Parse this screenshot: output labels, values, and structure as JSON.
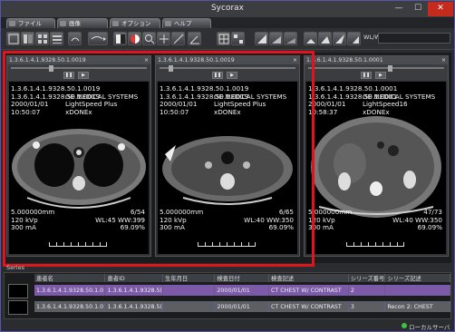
{
  "window": {
    "title": "Sycorax",
    "min": "—",
    "max": "☐",
    "close": "✕"
  },
  "menu": [
    {
      "label": "ファイル"
    },
    {
      "label": "画像"
    },
    {
      "label": "オプション"
    },
    {
      "label": "ヘルプ"
    }
  ],
  "toolbar": {
    "wlww_label": "WL/WW",
    "wlww_value": ""
  },
  "panes": [
    {
      "header": "1.3.6.1.4.1.9328.50.1.0019",
      "close": "×",
      "uid": "1.3.6.1.4.1.9328.50.1.0019",
      "uid2": "1.3.6.1.4.1.9328.50.1.0019",
      "date": "2000/01/01",
      "time": "10:50:07",
      "maker": "GE MEDICAL SYSTEMS",
      "model": "LightSpeed Plus",
      "station": "xDONEx",
      "thickness": "5.000000mm",
      "kvp": "120 kVp",
      "ma": "300 mA",
      "slice": "6/54",
      "wl": "WL:45 WW:399",
      "zoom": "69.09%"
    },
    {
      "header": "1.3.6.1.4.1.9328.50.1.0019",
      "close": "×",
      "uid": "1.3.6.1.4.1.9328.50.1.0019",
      "uid2": "1.3.6.1.4.1.9328.50.1.0019",
      "date": "2000/01/01",
      "time": "10:50:07",
      "maker": "GE MEDICAL SYSTEMS",
      "model": "LightSpeed Plus",
      "station": "xDONEx",
      "thickness": "5.000000mm",
      "kvp": "120 kVp",
      "ma": "300 mA",
      "slice": "6/65",
      "wl": "WL:40 WW:350",
      "zoom": "69.09%"
    },
    {
      "header": "1.3.6.1.4.1.9328.50.1.0001",
      "close": "×",
      "uid": "1.3.6.1.4.1.9328.50.1.0001",
      "uid2": "1.3.6.1.4.1.9328.50.1.0001",
      "date": "2000/01/01",
      "time": "10:58:37",
      "maker": "GE MEDICAL SYSTEMS",
      "model": "LightSpeed16",
      "station": "xDONEx",
      "thickness": "5.000000mm",
      "kvp": "120 kVp",
      "ma": "300 mA",
      "slice": "47/73",
      "wl": "WL:40 WW:350",
      "zoom": "69.09%"
    }
  ],
  "series": {
    "label": "Series",
    "columns": [
      "患者名",
      "患者ID",
      "生年月日",
      "検査日付",
      "検査記述",
      "シリーズ番号",
      "シリーズ記述"
    ],
    "rows": [
      [
        "1.3.6.1.4.1.9328.50.1.0",
        "1.3.6.1.4.1.9328.5(",
        "",
        "2000/01/01",
        "CT CHEST W/ CONTRAST",
        "2",
        ""
      ],
      [
        "1.3.6.1.4.1.9328.50.1.0",
        "1.3.6.1.4.1.9328.5(",
        "",
        "2000/01/01",
        "CT CHEST W/ CONTRAST",
        "3",
        "Recon 2: CHEST"
      ]
    ]
  },
  "status": {
    "text": "ローカルサーバ"
  }
}
